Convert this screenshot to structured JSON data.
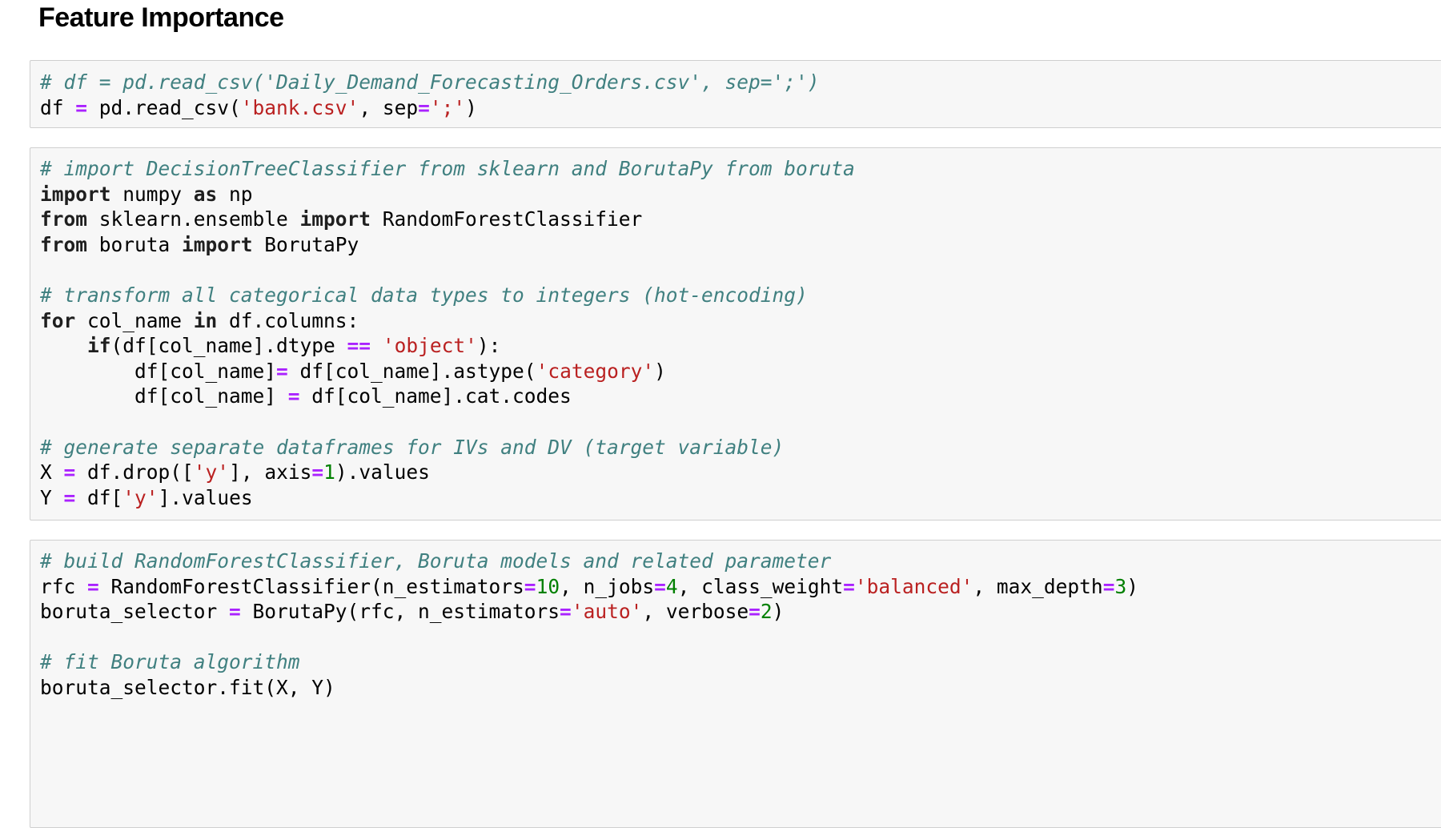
{
  "section": {
    "title": "Feature Importance"
  },
  "cells": {
    "c1": {
      "l1_comment": "# df = pd.read_csv('Daily_Demand_Forecasting_Orders.csv', sep=';')",
      "l2_a": "df ",
      "l2_op": "=",
      "l2_b": " pd.read_csv(",
      "l2_s1": "'bank.csv'",
      "l2_c": ", sep",
      "l2_op2": "=",
      "l2_s2": "';'",
      "l2_d": ")"
    },
    "c2": {
      "l1_comment": "# import DecisionTreeClassifier from sklearn and BorutaPy from boruta",
      "l2_k1": "import",
      "l2_a": " numpy ",
      "l2_k2": "as",
      "l2_b": " np",
      "l3_k1": "from",
      "l3_a": " sklearn.ensemble ",
      "l3_k2": "import",
      "l3_b": " RandomForestClassifier",
      "l4_k1": "from",
      "l4_a": " boruta ",
      "l4_k2": "import",
      "l4_b": " BorutaPy",
      "l6_comment": "# transform all categorical data types to integers (hot-encoding)",
      "l7_k1": "for",
      "l7_a": " col_name ",
      "l7_k2": "in",
      "l7_b": " df.columns:",
      "l8_indent": "    ",
      "l8_k1": "if",
      "l8_a": "(df[col_name].dtype ",
      "l8_op": "==",
      "l8_sp": " ",
      "l8_s": "'object'",
      "l8_b": "):",
      "l9_indent": "        ",
      "l9_a": "df[col_name]",
      "l9_op": "=",
      "l9_b": " df[col_name].astype(",
      "l9_s": "'category'",
      "l9_c": ")",
      "l10_indent": "        ",
      "l10_a": "df[col_name] ",
      "l10_op": "=",
      "l10_b": " df[col_name].cat.codes",
      "l12_comment": "# generate separate dataframes for IVs and DV (target variable)",
      "l13_a": "X ",
      "l13_op": "=",
      "l13_b": " df.drop([",
      "l13_s": "'y'",
      "l13_c": "], axis",
      "l13_op2": "=",
      "l13_n": "1",
      "l13_d": ").values",
      "l14_a": "Y ",
      "l14_op": "=",
      "l14_b": " df[",
      "l14_s": "'y'",
      "l14_c": "].values"
    },
    "c3": {
      "l1_comment": "# build RandomForestClassifier, Boruta models and related parameter",
      "l2_a": "rfc ",
      "l2_op": "=",
      "l2_b": " RandomForestClassifier(n_estimators",
      "l2_op2": "=",
      "l2_n1": "10",
      "l2_c": ", n_jobs",
      "l2_op3": "=",
      "l2_n2": "4",
      "l2_d": ", class_weight",
      "l2_op4": "=",
      "l2_s": "'balanced'",
      "l2_e": ", max_depth",
      "l2_op5": "=",
      "l2_n3": "3",
      "l2_f": ")",
      "l3_a": "boruta_selector ",
      "l3_op": "=",
      "l3_b": " BorutaPy(rfc, n_estimators",
      "l3_op2": "=",
      "l3_s": "'auto'",
      "l3_c": ", verbose",
      "l3_op3": "=",
      "l3_n": "2",
      "l3_d": ")",
      "l5_comment": "# fit Boruta algorithm",
      "l6_a": "boruta_selector.fit(X, Y)"
    }
  },
  "colors": {
    "comment": "#408080",
    "keyword": "#008000",
    "operator": "#aa22ff",
    "string": "#ba2121",
    "number": "#008000",
    "cell_background": "#f7f7f7",
    "cell_border": "#cfcfcf"
  }
}
